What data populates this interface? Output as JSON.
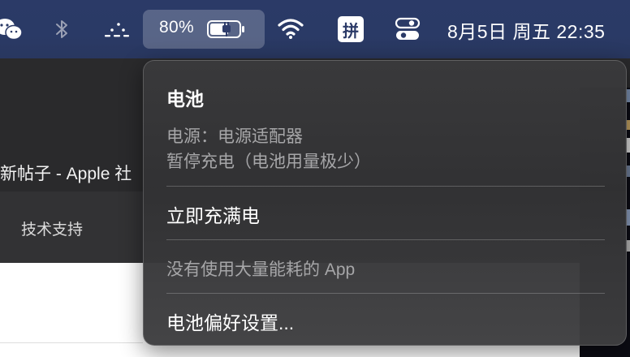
{
  "menubar": {
    "icons": [
      "wechat-icon",
      "bluetooth-icon",
      "dots-icon",
      "wifi-icon",
      "control-center-icon"
    ],
    "battery": {
      "percent": "80%",
      "charging": true
    },
    "input_method": "拼",
    "clock": "8月5日 周五  22:35"
  },
  "background_window": {
    "tab_title": "新帖子 - Apple 社",
    "subnav": "技术支持"
  },
  "battery_menu": {
    "title": "电池",
    "power_source": "电源：电源适配器",
    "charging_status": "暂停充电（电池用量极少）",
    "charge_now": "立即充满电",
    "no_energy_apps": "没有使用大量能耗的 App",
    "preferences": "电池偏好设置..."
  }
}
